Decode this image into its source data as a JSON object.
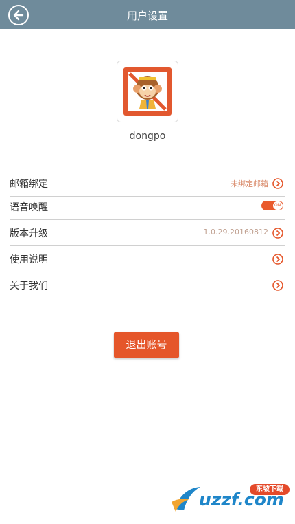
{
  "header": {
    "title": "用户设置"
  },
  "profile": {
    "username": "dongpo"
  },
  "settings": [
    {
      "label": "邮箱绑定",
      "value": "未绑定邮箱"
    },
    {
      "label": "语音唤醒",
      "toggle": "ON"
    },
    {
      "label": "版本升级",
      "value": "1.0.29.20160812"
    },
    {
      "label": "使用说明",
      "value": ""
    },
    {
      "label": "关于我们",
      "value": ""
    }
  ],
  "logout": {
    "label": "退出账号"
  },
  "watermark": {
    "text": "uzzf.com",
    "badge": "东坡下载"
  },
  "colors": {
    "header": "#6f8b9b",
    "accent": "#e5562a",
    "value_text": "#d98a6a"
  },
  "icons": {
    "back": "back-arrow-icon",
    "row_arrow": "chevron-right-circle-icon"
  }
}
